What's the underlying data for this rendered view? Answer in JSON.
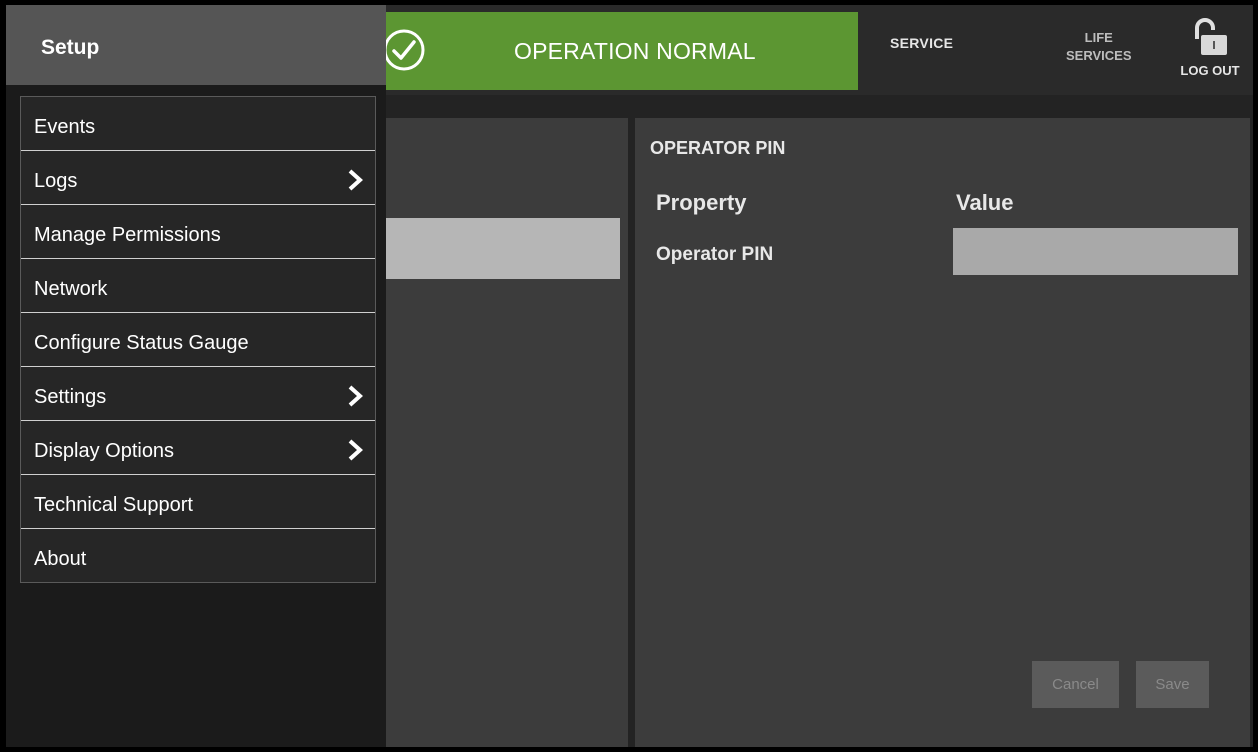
{
  "status_banner": {
    "text": "OPERATION NORMAL",
    "color": "#5c9632",
    "icon": "check-circle-icon"
  },
  "topbar": {
    "service_label": "SERVICE",
    "life_services_line1": "LIFE",
    "life_services_line2": "SERVICES",
    "logout_label": "LOG OUT",
    "logout_icon": "unlock-icon"
  },
  "drawer": {
    "title": "Setup",
    "items": [
      {
        "label": "Events",
        "has_submenu": false
      },
      {
        "label": "Logs",
        "has_submenu": true
      },
      {
        "label": "Manage Permissions",
        "has_submenu": false
      },
      {
        "label": "Network",
        "has_submenu": false
      },
      {
        "label": "Configure Status Gauge",
        "has_submenu": false
      },
      {
        "label": "Settings",
        "has_submenu": true
      },
      {
        "label": "Display Options",
        "has_submenu": true
      },
      {
        "label": "Technical Support",
        "has_submenu": false
      },
      {
        "label": "About",
        "has_submenu": false
      }
    ]
  },
  "detail": {
    "title": "OPERATOR PIN",
    "header_property": "Property",
    "header_value": "Value",
    "row_label": "Operator PIN",
    "row_value": "",
    "cancel_label": "Cancel",
    "save_label": "Save"
  }
}
